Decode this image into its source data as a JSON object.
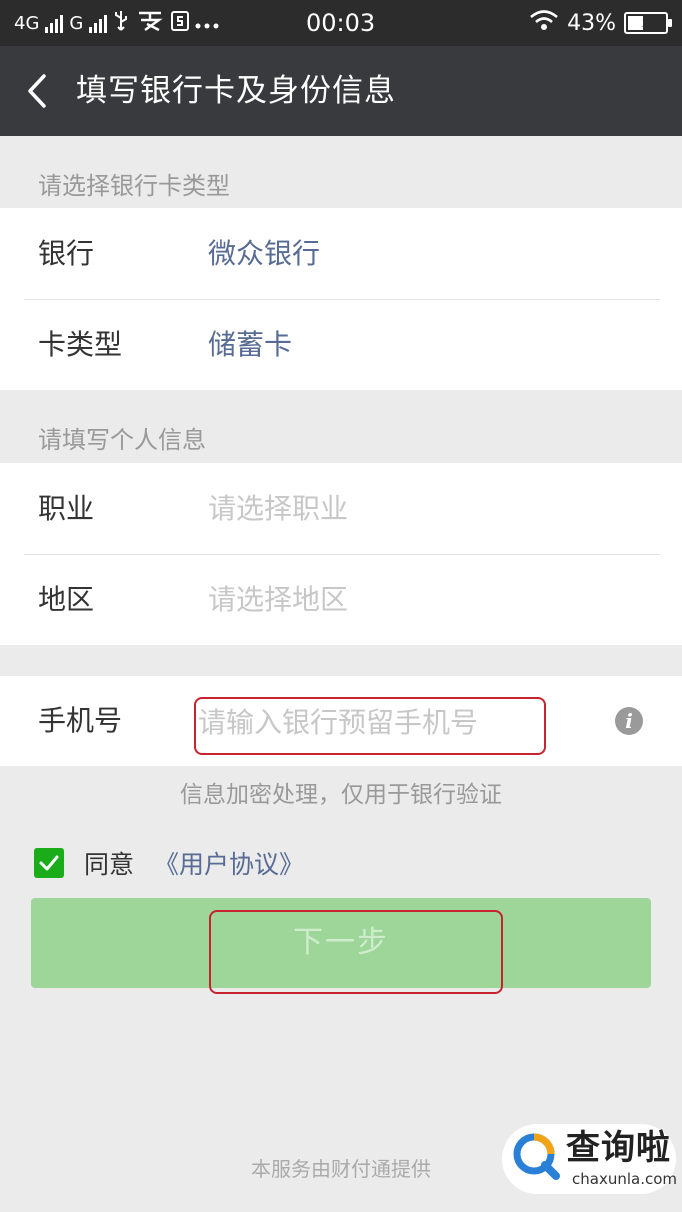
{
  "status_bar": {
    "net1": "4G",
    "net2": "G",
    "time": "00:03",
    "battery": "43%",
    "battery_level": 0.43
  },
  "nav": {
    "title": "填写银行卡及身份信息"
  },
  "card_section": {
    "label": "请选择银行卡类型",
    "bank_label": "银行",
    "bank_value": "微众银行",
    "card_type_label": "卡类型",
    "card_type_value": "储蓄卡"
  },
  "personal_section": {
    "label": "请填写个人信息",
    "occupation_label": "职业",
    "occupation_placeholder": "请选择职业",
    "region_label": "地区",
    "region_placeholder": "请选择地区"
  },
  "phone": {
    "label": "手机号",
    "placeholder": "请输入银行预留手机号",
    "value": ""
  },
  "hint": "信息加密处理，仅用于银行验证",
  "agreement": {
    "checked": true,
    "text": "同意",
    "link": "《用户协议》"
  },
  "next_button": "下一步",
  "footer": "本服务由财付通提供",
  "watermark": {
    "main": "查询啦",
    "sub": "chaxunla.com"
  },
  "colors": {
    "nav_background": "#393a3e",
    "link": "#576b95",
    "checkbox": "#1aad19",
    "next_button_disabled": "#9ed599",
    "highlight_box": "#c8232f"
  }
}
